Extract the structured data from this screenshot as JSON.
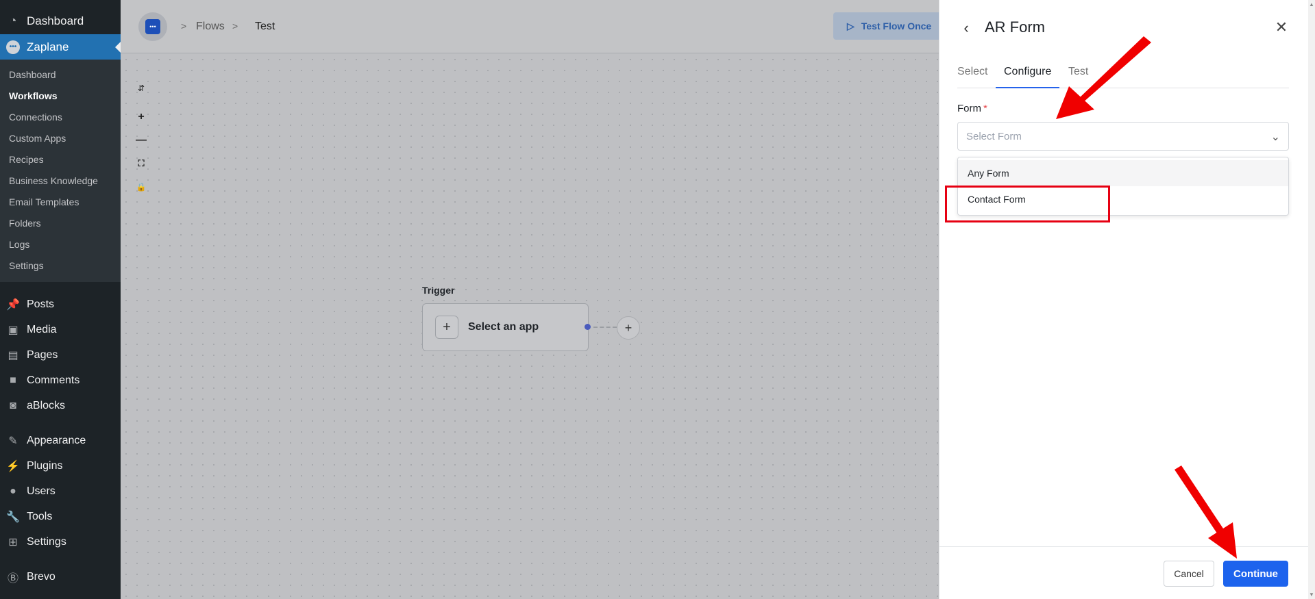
{
  "sidebar": {
    "top_label": "Dashboard",
    "active_label": "Zaplane",
    "submenu": [
      "Dashboard",
      "Workflows",
      "Connections",
      "Custom Apps",
      "Recipes",
      "Business Knowledge",
      "Email Templates",
      "Folders",
      "Logs",
      "Settings"
    ],
    "current_submenu": "Workflows",
    "menu_group1": [
      {
        "label": "Posts",
        "icon": "pushpin-icon"
      },
      {
        "label": "Media",
        "icon": "media-icon"
      },
      {
        "label": "Pages",
        "icon": "pages-icon"
      },
      {
        "label": "Comments",
        "icon": "comments-icon"
      },
      {
        "label": "aBlocks",
        "icon": "ablocks-icon"
      }
    ],
    "menu_group2": [
      {
        "label": "Appearance",
        "icon": "appearance-icon"
      },
      {
        "label": "Plugins",
        "icon": "plugins-icon"
      },
      {
        "label": "Users",
        "icon": "users-icon"
      },
      {
        "label": "Tools",
        "icon": "tools-icon"
      },
      {
        "label": "Settings",
        "icon": "settings-icon"
      }
    ],
    "bottom_label": "Brevo"
  },
  "topbar": {
    "breadcrumb": [
      "Flows",
      "Test"
    ],
    "test_button": "Test Flow Once"
  },
  "canvas": {
    "trigger_label": "Trigger",
    "node_text": "Select an app"
  },
  "panel": {
    "title": "AR Form",
    "tabs": [
      "Select",
      "Configure",
      "Test"
    ],
    "active_tab": "Configure",
    "field_label": "Form",
    "required_mark": "*",
    "select_placeholder": "Select Form",
    "options": [
      "Any Form",
      "Contact Form"
    ],
    "cancel": "Cancel",
    "continue": "Continue"
  },
  "colors": {
    "accent": "#1d63ed",
    "sidebar_bg": "#1d23272",
    "annotation": "#e60012"
  }
}
